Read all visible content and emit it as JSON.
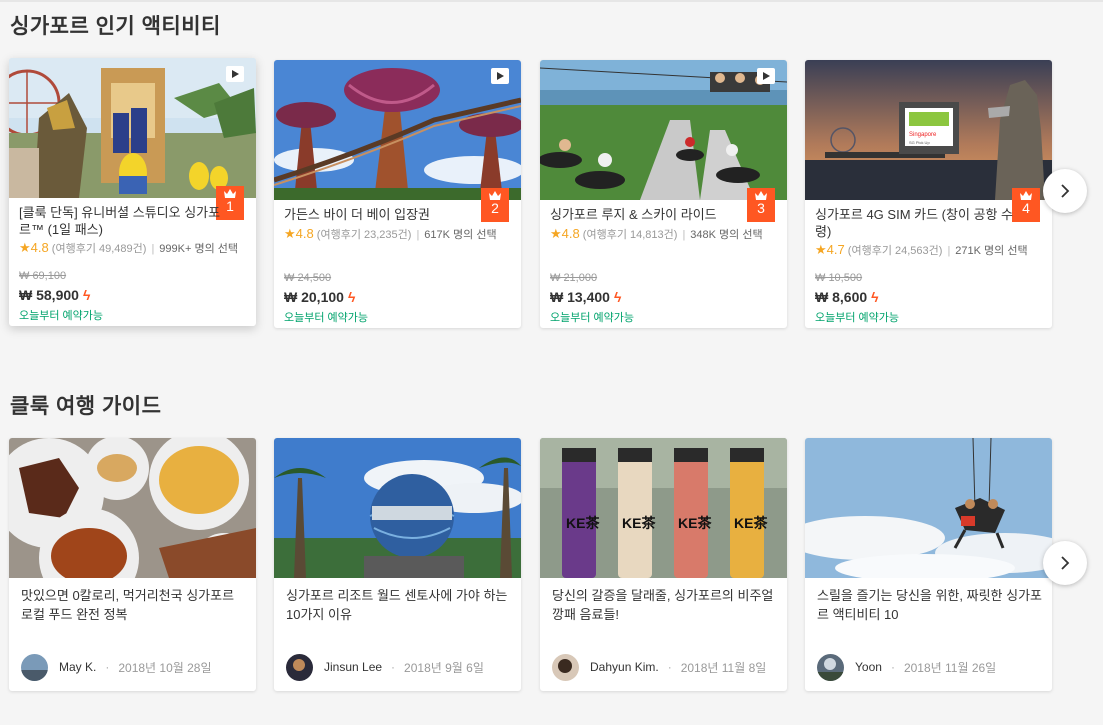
{
  "sections": {
    "popular_title": "싱가포르 인기 액티비티",
    "guide_title": "클룩 여행 가이드"
  },
  "currency_symbol": "₩",
  "bolt_icon": "lightning-icon",
  "products": [
    {
      "title": "[클룩 단독] 유니버셜 스튜디오 싱가포르™ (1일 패스)",
      "rank": "1",
      "score": "4.8",
      "reviews": "(여행후기 49,489건)",
      "booked": "999K+ 명의 선택",
      "old_price": "₩ 69,100",
      "price": "₩ 58,900",
      "availability": "오늘부터 예약가능",
      "has_video": true
    },
    {
      "title": "가든스 바이 더 베이 입장권",
      "rank": "2",
      "score": "4.8",
      "reviews": "(여행후기 23,235건)",
      "booked": "617K 명의 선택",
      "old_price": "₩ 24,500",
      "price": "₩ 20,100",
      "availability": "오늘부터 예약가능",
      "has_video": true
    },
    {
      "title": "싱가포르 루지 & 스카이 라이드",
      "rank": "3",
      "score": "4.8",
      "reviews": "(여행후기 14,813건)",
      "booked": "348K 명의 선택",
      "old_price": "₩ 21,000",
      "price": "₩ 13,400",
      "availability": "오늘부터 예약가능",
      "has_video": true
    },
    {
      "title": "싱가포르 4G SIM 카드 (창이 공항 수령)",
      "rank": "4",
      "score": "4.7",
      "reviews": "(여행후기 24,563건)",
      "booked": "271K 명의 선택",
      "old_price": "₩ 10,500",
      "price": "₩ 8,600",
      "availability": "오늘부터 예약가능",
      "has_video": false
    }
  ],
  "guides": [
    {
      "title": "맛있으면 0칼로리, 먹거리천국 싱가포르 로컬 푸드 완전 정복",
      "author": "May K.",
      "date": "2018년 10월 28일"
    },
    {
      "title": "싱가포르 리조트 월드 센토사에 가야 하는 10가지 이유",
      "author": "Jinsun Lee",
      "date": "2018년 9월 6일"
    },
    {
      "title": "당신의 갈증을 달래줄, 싱가포르의 비주얼깡패 음료들!",
      "author": "Dahyun Kim.",
      "date": "2018년 11월 8일"
    },
    {
      "title": "스릴을 즐기는 당신을 위한, 짜릿한 싱가포르 액티비티 10",
      "author": "Yoon",
      "date": "2018년 11월 26일"
    }
  ],
  "sim_card_image_text": {
    "brand": "Singapore",
    "sub": "SG Pick Up"
  },
  "bottle_text": "KE茶",
  "colors": {
    "accent": "#ff5722",
    "available": "#00a36c",
    "star": "#f5a623"
  }
}
